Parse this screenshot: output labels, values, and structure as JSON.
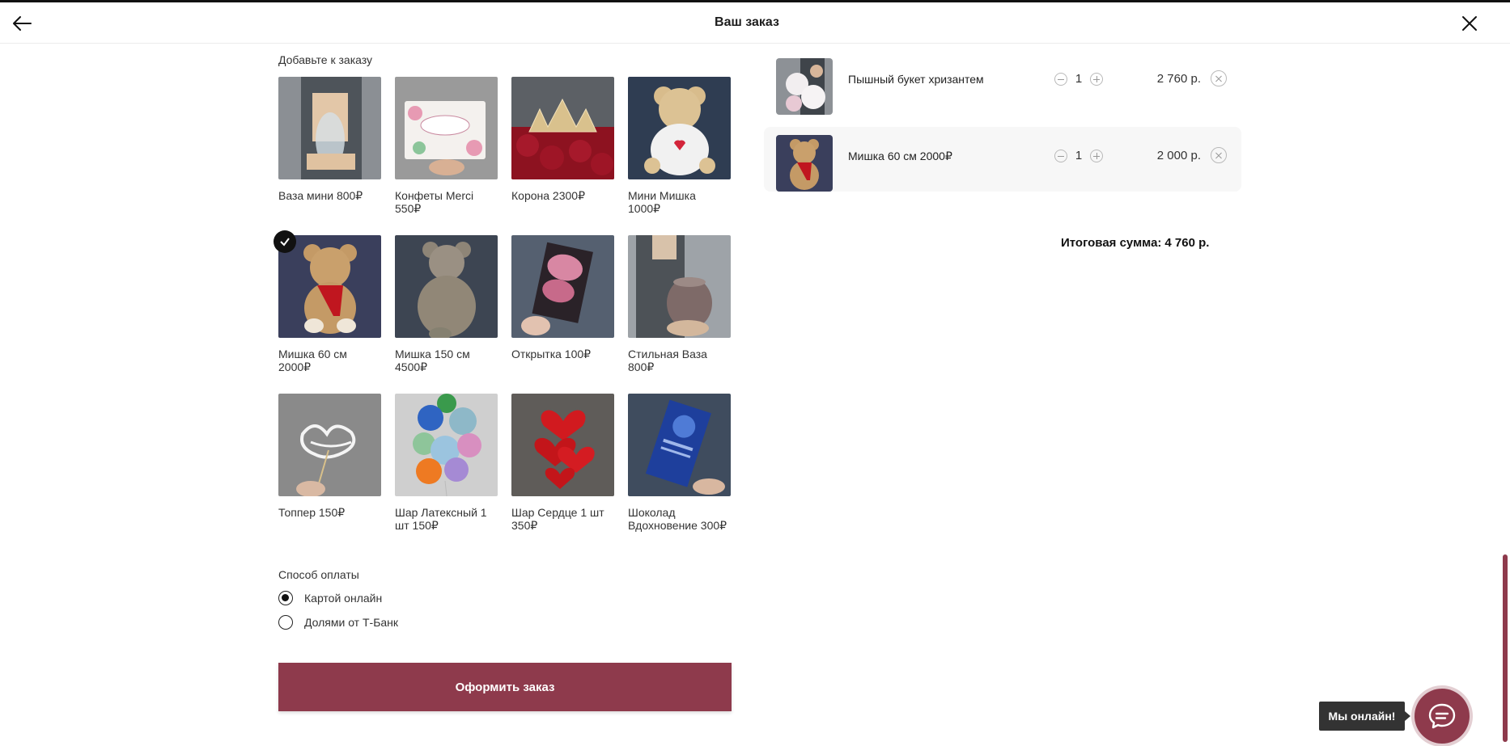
{
  "header": {
    "title": "Ваш заказ",
    "back_icon": "arrow-left-icon",
    "close_icon": "close-icon"
  },
  "upsell": {
    "title": "Добавьте к заказу",
    "items": [
      {
        "label": "Ваза мини 800₽",
        "selected": false,
        "image": "vase-photo"
      },
      {
        "label": "Конфеты Merci 550₽",
        "selected": false,
        "image": "candy-box-photo"
      },
      {
        "label": "Корона 2300₽",
        "selected": false,
        "image": "crown-roses-photo"
      },
      {
        "label": "Мини Мишка 1000₽",
        "selected": false,
        "image": "teddy-small-photo"
      },
      {
        "label": "Мишка 60 см 2000₽",
        "selected": true,
        "image": "teddy-60-photo"
      },
      {
        "label": "Мишка 150 см 4500₽",
        "selected": false,
        "image": "teddy-150-photo"
      },
      {
        "label": "Открытка 100₽",
        "selected": false,
        "image": "card-photo"
      },
      {
        "label": "Стильная Ваза 800₽",
        "selected": false,
        "image": "glass-vase-photo"
      },
      {
        "label": "Топпер 150₽",
        "selected": false,
        "image": "topper-photo"
      },
      {
        "label": "Шар Латексный 1 шт 150₽",
        "selected": false,
        "image": "latex-balloons-photo"
      },
      {
        "label": "Шар Сердце 1 шт 350₽",
        "selected": false,
        "image": "heart-balloons-photo"
      },
      {
        "label": "Шоколад Вдохновение 300₽",
        "selected": false,
        "image": "chocolate-photo"
      }
    ]
  },
  "payment": {
    "title": "Способ оплаты",
    "options": [
      {
        "label": "Картой онлайн",
        "selected": true
      },
      {
        "label": "Долями от Т-Банк",
        "selected": false
      }
    ]
  },
  "submit_label": "Оформить заказ",
  "cart": {
    "items": [
      {
        "name": "Пышный букет хризантем",
        "qty": "1",
        "price": "2 760 р."
      },
      {
        "name": "Мишка 60 см 2000₽",
        "qty": "1",
        "price": "2 000 р."
      }
    ],
    "total_label": "Итоговая сумма:",
    "total_value": "4 760 р."
  },
  "chat": {
    "tooltip": "Мы онлайн!",
    "icon": "chat-bubble-icon"
  },
  "colors": {
    "accent": "#8e3a4c",
    "text": "#1d1d1d",
    "row_bg": "#f7f7f7"
  }
}
